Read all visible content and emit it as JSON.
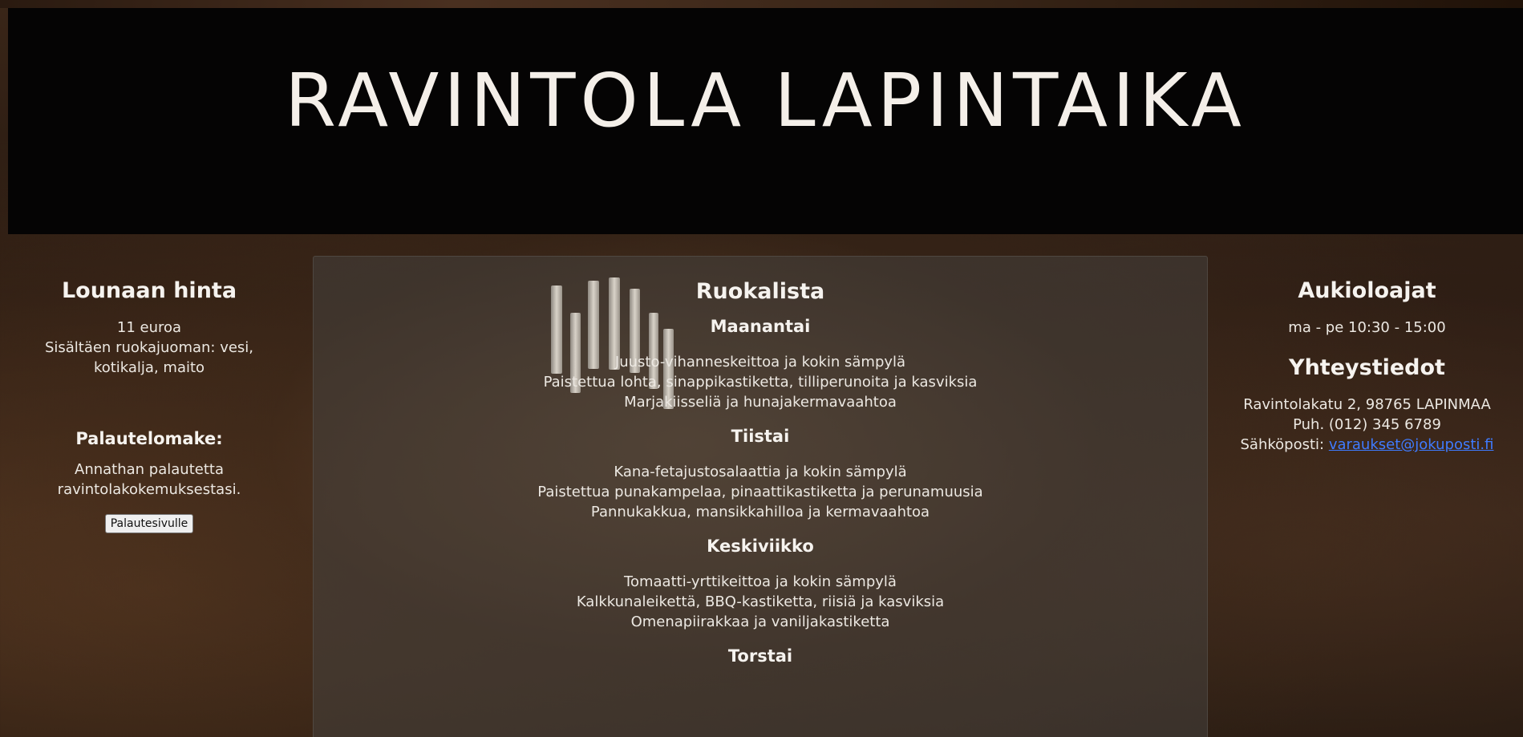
{
  "header": {
    "title": "RAVINTOLA LAPINTAIKA"
  },
  "lunch_price": {
    "heading": "Lounaan hinta",
    "price": "11 euroa",
    "drinks_line1": "Sisältäen ruokajuoman: vesi,",
    "drinks_line2": "kotikalja, maito"
  },
  "feedback": {
    "heading": "Palautelomake:",
    "text_line1": "Annathan palautetta",
    "text_line2": "ravintolakokemuksestasi.",
    "button_label": "Palautesivulle"
  },
  "menu": {
    "title": "Ruokalista",
    "days": [
      {
        "name": "Maanantai",
        "dishes": [
          "Juusto-vihanneskeittoa ja kokin sämpylä",
          "Paistettua lohta, sinappikastiketta, tilliperunoita ja kasviksia",
          "Marjakiisseliä ja hunajakermavaahtoa"
        ]
      },
      {
        "name": "Tiistai",
        "dishes": [
          "Kana-fetajustosalaattia ja kokin sämpylä",
          "Paistettua punakampelaa, pinaattikastiketta ja perunamuusia",
          "Pannukakkua, mansikkahilloa ja kermavaahtoa"
        ]
      },
      {
        "name": "Keskiviikko",
        "dishes": [
          "Tomaatti-yrttikeittoa ja kokin sämpylä",
          "Kalkkunaleikettä, BBQ-kastiketta, riisiä ja kasviksia",
          "Omenapiirakkaa ja vaniljakastiketta"
        ]
      },
      {
        "name": "Torstai",
        "dishes": []
      }
    ]
  },
  "opening_hours": {
    "heading": "Aukioloajat",
    "hours": "ma - pe 10:30 - 15:00"
  },
  "contact": {
    "heading": "Yhteystiedot",
    "address": "Ravintolakatu 2, 98765 LAPINMAA",
    "phone": "Puh. (012) 345 6789",
    "email_label": "Sähköposti: ",
    "email": "varaukset@jokuposti.fi"
  }
}
